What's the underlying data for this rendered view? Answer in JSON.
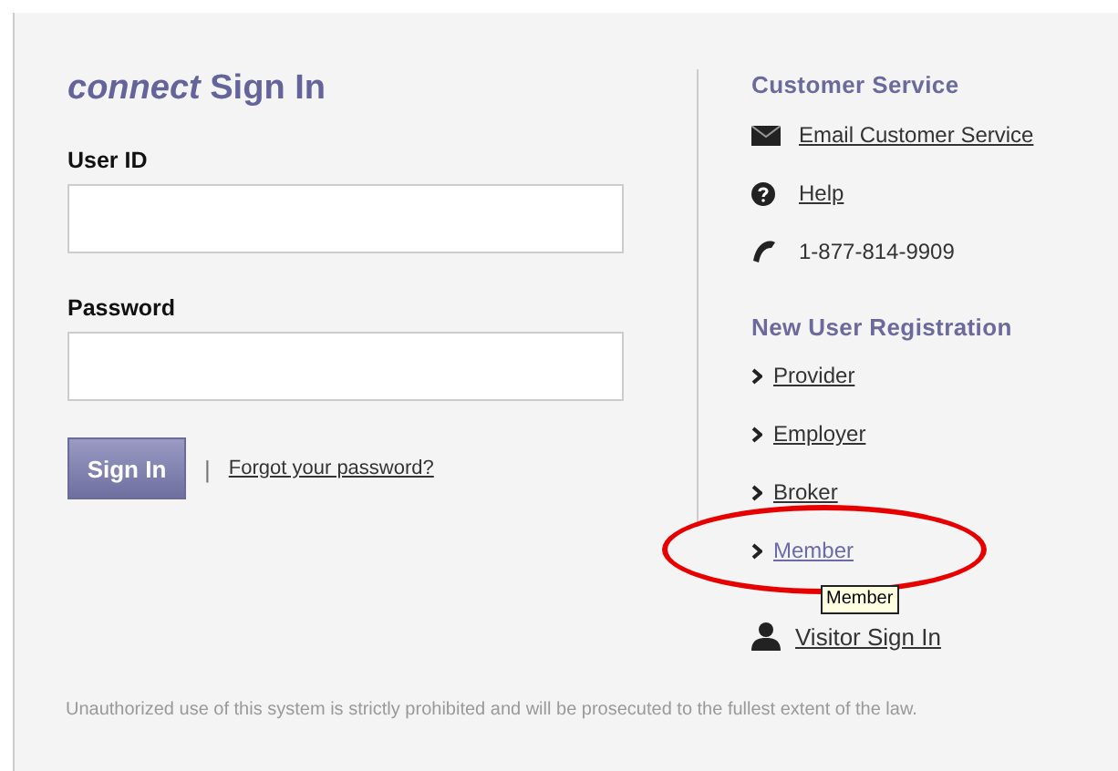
{
  "sign_in": {
    "title": "*connect* Sign In",
    "fields": [
      {
        "label": "User ID"
      },
      {
        "label": "Password"
      }
    ],
    "button": "Sign In",
    "separator": "|",
    "forgot_link": "Forgot your password?"
  },
  "customer_service": {
    "heading": "Customer Service",
    "items": [
      {
        "kind": "email",
        "label": "Email Customer Service"
      },
      {
        "kind": "help",
        "label": "Help"
      },
      {
        "kind": "phone",
        "label": "1-877-814-9909"
      }
    ]
  },
  "registration": {
    "heading": "New User Registration",
    "items": [
      {
        "label": "Provider",
        "hovered": false,
        "highlighted": false
      },
      {
        "label": "Employer",
        "hovered": false,
        "highlighted": false
      },
      {
        "label": "Broker",
        "hovered": false,
        "highlighted": false
      },
      {
        "label": "Member",
        "hovered": true,
        "highlighted": true,
        "tooltip": "Member"
      }
    ]
  },
  "visitor_link": "Visitor Sign In",
  "disclaimer": "Unauthorized use of this system is strictly prohibited and will be prosecuted to the fullest extent of the law."
}
